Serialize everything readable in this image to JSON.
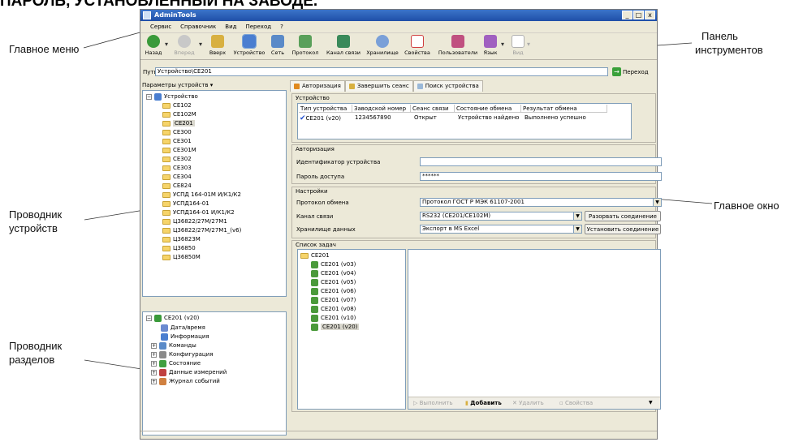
{
  "heading": "ПАРОЛЬ, УСТАНОВЛЕННЫЙ НА ЗАВОДЕ.",
  "callouts": {
    "main_menu": "Главное меню",
    "toolbar": [
      "Панель",
      "инструментов"
    ],
    "device_explorer": [
      "Проводник",
      "устройств"
    ],
    "main_window": "Главное окно",
    "section_explorer": [
      "Проводник",
      "разделов"
    ]
  },
  "window": {
    "title": "AdminTools",
    "buttons": [
      "_",
      "□",
      "x"
    ]
  },
  "menu": [
    "Сервис",
    "Справочник",
    "Вид",
    "Переход",
    "?"
  ],
  "toolbar": [
    {
      "label": "Назад",
      "icon": "back-icon",
      "color": "#3a9a3a"
    },
    {
      "label": "Вперед",
      "icon": "forward-icon",
      "color": "#b0b0b0"
    },
    {
      "label": "Вверх",
      "icon": "up-icon",
      "color": "#d8b040"
    },
    {
      "label": "Устройство",
      "icon": "device-icon",
      "color": "#4a7ed0"
    },
    {
      "label": "Сеть",
      "icon": "network-icon",
      "color": "#5a8ac8"
    },
    {
      "label": "Протокол",
      "icon": "protocol-icon",
      "color": "#5aa05a"
    },
    {
      "label": "Канал связи",
      "icon": "channel-icon",
      "color": "#3a8a5a"
    },
    {
      "label": "Хранилище",
      "icon": "storage-icon",
      "color": "#7aa0d8"
    },
    {
      "label": "Свойства",
      "icon": "properties-icon",
      "color": "#d04040"
    },
    {
      "label": "Пользователи",
      "icon": "users-icon",
      "color": "#c05080"
    },
    {
      "label": "Язык",
      "icon": "language-icon",
      "color": "#a060c0"
    },
    {
      "label": "Вид",
      "icon": "view-icon",
      "color": "#b0b0b0"
    }
  ],
  "address": {
    "label": "Путь:",
    "value": "Устройство\\CE201",
    "go": "Переход"
  },
  "device_panel": {
    "header": "Параметры устройств ▾",
    "root": "Устройство",
    "items": [
      "CE102",
      "CE102M",
      "CE201",
      "CE300",
      "CE301",
      "CE301M",
      "CE302",
      "CE303",
      "CE304",
      "CE824",
      "УСПД 164-01М И/К1/К2",
      "УСПД164-01",
      "УСПД164-01 И/К1/К2",
      "Ц36822/27М/27М1",
      "Ц36822/27М/27М1_(v6)",
      "Ц36823М",
      "Ц36850",
      "Ц36850М"
    ],
    "selected": "CE201"
  },
  "section_panel": {
    "root": "CE201 (v20)",
    "items": [
      {
        "label": "Дата/время",
        "icon": "clock-icon",
        "color": "#6a8ad0",
        "expand": false
      },
      {
        "label": "Информация",
        "icon": "info-icon",
        "color": "#4a7ed0",
        "expand": false
      },
      {
        "label": "Команды",
        "icon": "commands-icon",
        "color": "#5a8ac8",
        "expand": true
      },
      {
        "label": "Конфигурация",
        "icon": "config-icon",
        "color": "#8a8a8a",
        "expand": true
      },
      {
        "label": "Состояние",
        "icon": "status-icon",
        "color": "#40a040",
        "expand": true
      },
      {
        "label": "Данные измерений",
        "icon": "measurements-icon",
        "color": "#c04040",
        "expand": true
      },
      {
        "label": "Журнал событий",
        "icon": "event-log-icon",
        "color": "#d08040",
        "expand": true
      }
    ]
  },
  "tabs": [
    "Авторизация",
    "Завершить сеанс",
    "Поиск устройства"
  ],
  "device_group": {
    "title": "Устройство",
    "columns": [
      "Тип устройства",
      "Заводской номер",
      "Сеанс связи",
      "Состояние обмена",
      "Результат обмена"
    ],
    "row": [
      "CE201 (v20)",
      "1234567890",
      "Открыт",
      "Устройство найдено",
      "Выполнено успешно"
    ]
  },
  "auth_group": {
    "title": "Авторизация",
    "device_id_label": "Идентификатор устройства",
    "device_id_value": "",
    "password_label": "Пароль доступа",
    "password_value": "******"
  },
  "settings_group": {
    "title": "Настройки",
    "protocol_label": "Протокол обмена",
    "protocol_value": "Протокол ГОСТ Р МЭК 61107-2001",
    "channel_label": "Канал связи",
    "channel_value": "RS232 (CE201/CE102M)",
    "storage_label": "Хранилище данных",
    "storage_value": "Экспорт в MS Excel",
    "disconnect_button": "Разорвать соединение",
    "connect_button": "Установить соединение"
  },
  "tasks_group": {
    "title": "Список задач",
    "root": "CE201",
    "items": [
      "CE201 (v03)",
      "CE201 (v04)",
      "CE201 (v05)",
      "CE201 (v06)",
      "CE201 (v07)",
      "CE201 (v08)",
      "CE201 (v10)",
      "CE201 (v20)"
    ],
    "selected": "CE201 (v20)",
    "buttons": {
      "run": "Выполнить",
      "add": "Добавить",
      "delete": "Удалить",
      "properties": "Свойства"
    }
  }
}
